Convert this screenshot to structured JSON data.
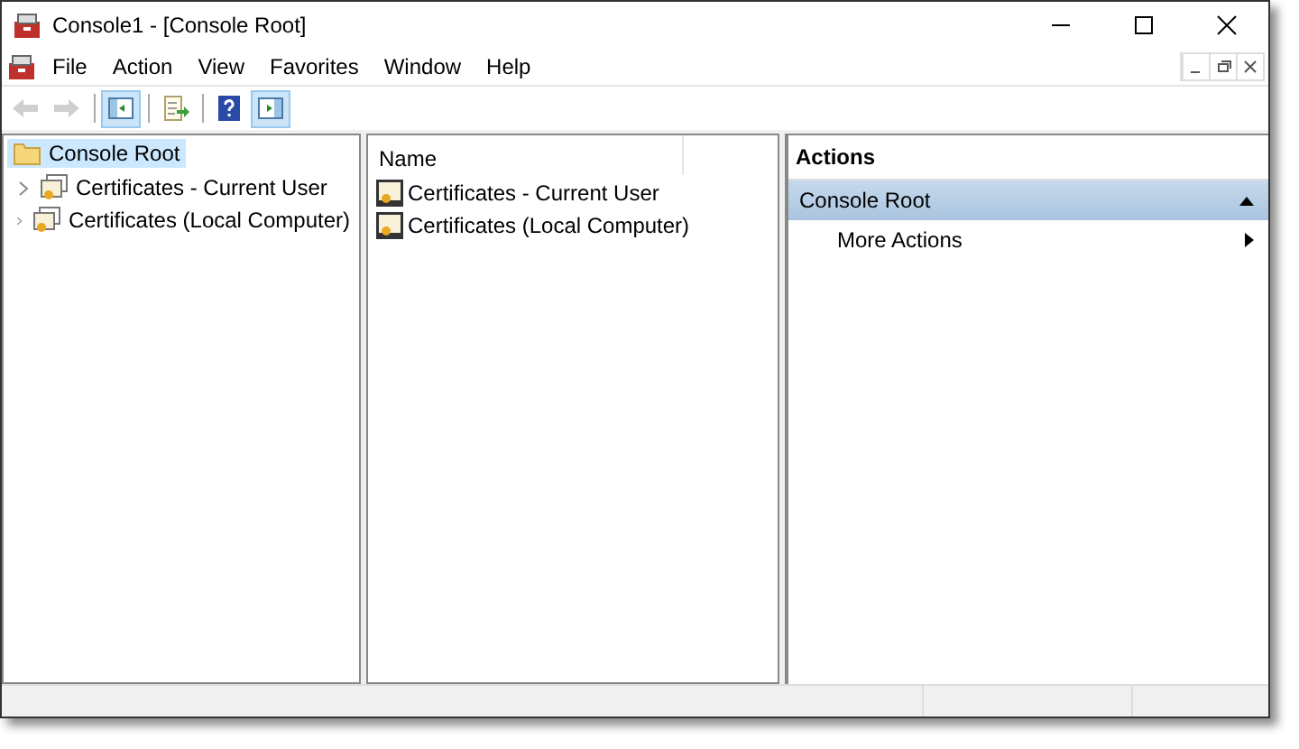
{
  "window": {
    "title": "Console1 - [Console Root]"
  },
  "menu": [
    "File",
    "Action",
    "View",
    "Favorites",
    "Window",
    "Help"
  ],
  "toolbar": [
    {
      "kind": "back",
      "on": false,
      "disabled": true
    },
    {
      "kind": "forward",
      "on": false,
      "disabled": true
    },
    {
      "kind": "tree",
      "on": true,
      "disabled": false
    },
    {
      "kind": "export",
      "on": false,
      "disabled": false
    },
    {
      "kind": "help",
      "on": false,
      "disabled": false
    },
    {
      "kind": "actionpane",
      "on": true,
      "disabled": false
    }
  ],
  "tree": {
    "label": "Console Root",
    "selected": true,
    "children": [
      {
        "label": "Certificates - Current User",
        "selected": false,
        "expanded": false
      },
      {
        "label": "Certificates (Local Computer)",
        "selected": false,
        "expanded": false
      }
    ]
  },
  "list": {
    "columns": [
      "Name"
    ],
    "rows": [
      "Certificates - Current User",
      "Certificates (Local Computer)"
    ]
  },
  "actions": {
    "title": "Actions",
    "sections": [
      {
        "label": "Console Root",
        "expanded": true,
        "items": [
          "More Actions"
        ]
      }
    ]
  }
}
